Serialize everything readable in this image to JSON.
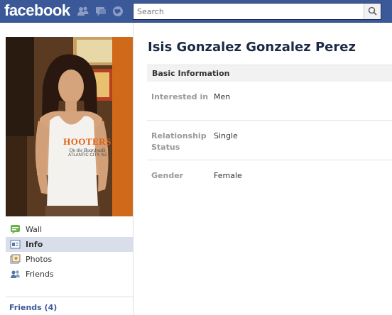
{
  "topbar": {
    "logo": "facebook",
    "search_placeholder": "Search",
    "icons": [
      "friend-requests-icon",
      "messages-icon",
      "notifications-icon",
      "search-icon"
    ]
  },
  "profile": {
    "name": "Isis Gonzalez Gonzalez Perez",
    "photo_text": {
      "brand": "HOOTERS",
      "line2": "On the Boardwalk",
      "line3": "ATLANTIC CITY, NJ"
    }
  },
  "nav": {
    "items": [
      {
        "label": "Wall",
        "icon": "wall-icon",
        "active": false
      },
      {
        "label": "Info",
        "icon": "info-icon",
        "active": true
      },
      {
        "label": "Photos",
        "icon": "photos-icon",
        "active": false
      },
      {
        "label": "Friends",
        "icon": "friends-icon",
        "active": false
      }
    ]
  },
  "friends_box": {
    "label": "Friends (4)"
  },
  "basic_info": {
    "header": "Basic Information",
    "rows": [
      {
        "label": "Interested in",
        "value": "Men"
      },
      {
        "label": "Relationship Status",
        "value": "Single"
      },
      {
        "label": "Gender",
        "value": "Female"
      }
    ]
  },
  "colors": {
    "brand_blue": "#3b5998",
    "nav_active": "#d8dfea",
    "name_color": "#1c2a47",
    "label_gray": "#999999"
  }
}
